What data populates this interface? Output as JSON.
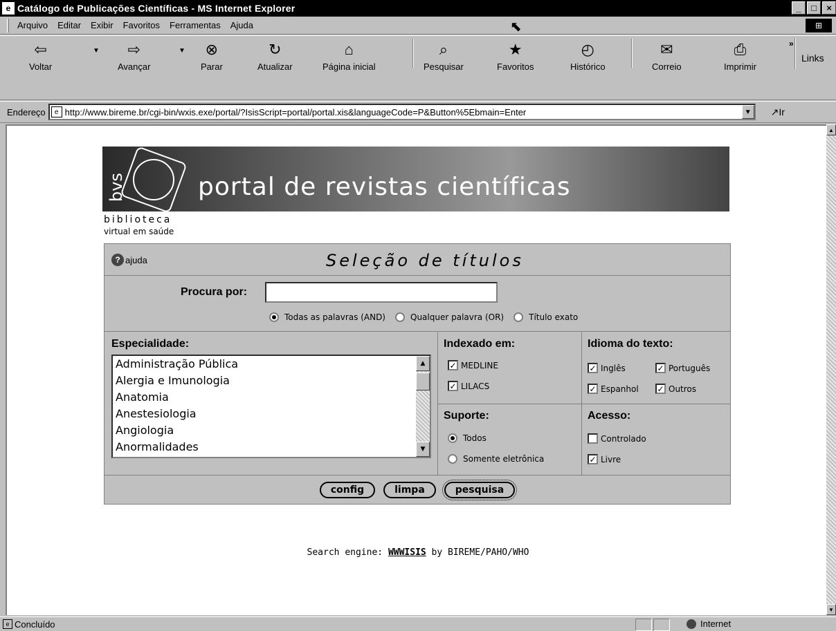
{
  "window": {
    "title": "Catálogo de Publicações Científicas - MS Internet Explorer",
    "icon": "ie-page-icon",
    "controls": [
      "_",
      "□",
      "×"
    ]
  },
  "menu": {
    "items": [
      "Arquivo",
      "Editar",
      "Exibir",
      "Favoritos",
      "Ferramentas",
      "Ajuda"
    ]
  },
  "toolbar": {
    "buttons": [
      {
        "label": "Voltar",
        "icon": "⇦"
      },
      {
        "label": "Avançar",
        "icon": "⇨"
      },
      {
        "label": "Parar",
        "icon": "⊗"
      },
      {
        "label": "Atualizar",
        "icon": "↻"
      },
      {
        "label": "Página inicial",
        "icon": "⌂"
      },
      {
        "label": "Pesquisar",
        "icon": "⌕"
      },
      {
        "label": "Favoritos",
        "icon": "★"
      },
      {
        "label": "Histórico",
        "icon": "◴"
      },
      {
        "label": "Correio",
        "icon": "✉"
      },
      {
        "label": "Imprimir",
        "icon": "⎙"
      }
    ],
    "links": "Links",
    "more": "»"
  },
  "address": {
    "label": "Endereço",
    "url": "http://www.bireme.br/cgi-bin/wxis.exe/portal/?IsisScript=portal/portal.xis&languageCode=P&Button%5Ebmain=Enter",
    "go": "↗Ir"
  },
  "banner": {
    "logo": "bvs",
    "title": "portal de revistas científicas",
    "bib_line1": "biblioteca",
    "bib_line2": "virtual em saúde"
  },
  "form": {
    "help": "ajuda",
    "heading": "Seleção de títulos",
    "search_label": "Procura por:",
    "search_value": "",
    "search_modes": [
      {
        "label": "Todas as palavras (AND)",
        "checked": true
      },
      {
        "label": "Qualquer palavra (OR)",
        "checked": false
      },
      {
        "label": "Título exato",
        "checked": false
      }
    ],
    "specialty_label": "Especialidade:",
    "specialties": [
      "Administração Pública",
      "Alergia e Imunologia",
      "Anatomia",
      "Anestesiologia",
      "Angiologia",
      "Anormalidades"
    ],
    "indexed_label": "Indexado em:",
    "indexed": [
      {
        "label": "MEDLINE",
        "checked": true
      },
      {
        "label": "LILACS",
        "checked": true
      }
    ],
    "language_label": "Idioma do texto:",
    "languages": [
      {
        "label": "Inglês",
        "checked": true
      },
      {
        "label": "Português",
        "checked": true
      },
      {
        "label": "Espanhol",
        "checked": true
      },
      {
        "label": "Outros",
        "checked": true
      }
    ],
    "support_label": "Suporte:",
    "support": [
      {
        "label": "Todos",
        "checked": true
      },
      {
        "label": "Somente eletrônica",
        "checked": false
      }
    ],
    "access_label": "Acesso:",
    "access": [
      {
        "label": "Controlado",
        "checked": false
      },
      {
        "label": "Livre",
        "checked": true
      }
    ],
    "buttons": [
      "config",
      "limpa",
      "pesquisa"
    ]
  },
  "footer": {
    "prefix": "Search engine: ",
    "link": "WWWISIS",
    "suffix": " by BIREME/PAHO/WHO"
  },
  "status": {
    "text": "Concluído",
    "zone": "Internet"
  }
}
